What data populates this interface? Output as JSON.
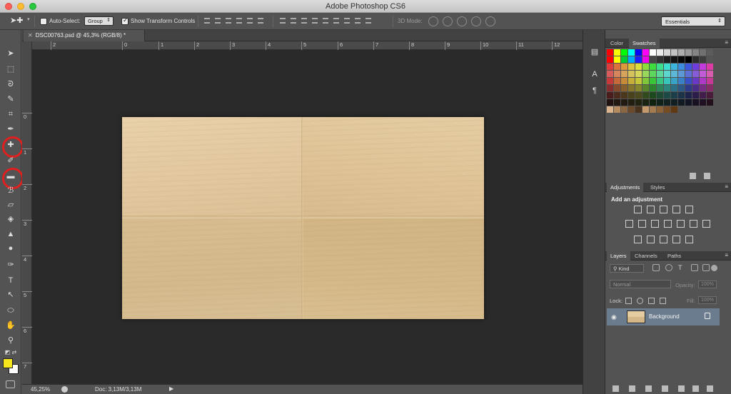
{
  "window": {
    "title": "Adobe Photoshop CS6"
  },
  "options_bar": {
    "auto_select_label": "Auto-Select:",
    "auto_select_value": "Group",
    "show_transform_label": "Show Transform Controls",
    "three_d_mode_label": "3D Mode:",
    "workspace_value": "Essentials"
  },
  "document": {
    "tab_label": "DSC00763.psd @ 45,3% (RGB/8) *",
    "ruler_h": [
      "2",
      "0",
      "1",
      "2",
      "3",
      "4",
      "5",
      "6",
      "7",
      "8",
      "9",
      "10",
      "11",
      "12"
    ],
    "ruler_v": [
      "0",
      "1",
      "2",
      "3",
      "4",
      "5",
      "6",
      "7"
    ]
  },
  "status": {
    "zoom": "45,25%",
    "doc_info": "Doc: 3,13M/3,13M"
  },
  "colors": {
    "foreground": "#f6e41c",
    "background": "#ffffff"
  },
  "swatches_panel": {
    "tabs": [
      "Color",
      "Swatches"
    ],
    "active_tab": "Swatches"
  },
  "adjustments_panel": {
    "tabs": [
      "Adjustments",
      "Styles"
    ],
    "active_tab": "Adjustments",
    "heading": "Add an adjustment"
  },
  "layers_panel": {
    "tabs": [
      "Layers",
      "Channels",
      "Paths"
    ],
    "active_tab": "Layers",
    "filter_value": "Kind",
    "blend_mode": "Normal",
    "opacity_label": "Opacity:",
    "opacity_value": "100%",
    "lock_label": "Lock:",
    "fill_label": "Fill:",
    "fill_value": "100%",
    "layers": [
      {
        "name": "Background",
        "visible": true,
        "locked": true
      }
    ]
  }
}
